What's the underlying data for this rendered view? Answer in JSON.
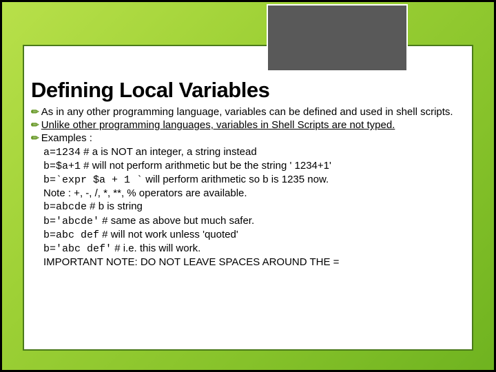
{
  "title": "Defining Local Variables",
  "bullets": {
    "b1": "As in any other programming language, variables can be defined and used in shell scripts.",
    "b2": "Unlike other programming languages, variables in Shell Scripts are not typed.",
    "b3_label": "Examples :",
    "ex1_code": "a=1234",
    "ex1_comment": "  # a is NOT an integer, a string instead",
    "ex2_code": "b=$a+1",
    "ex2_comment": " # will not perform arithmetic but be the string ' 1234+1'",
    "ex3_code": "b=`expr $a + 1 `",
    "ex3_comment": "   will perform arithmetic so b is 1235 now.",
    "ex3_note": "       Note : +, -, /, *, **, % operators are available.",
    "ex4_code": "b=abcde",
    "ex4_comment": "  # b is string",
    "ex5_code": "b='abcde'",
    "ex5_comment": " # same as above but much safer.",
    "ex6_code": "b=abc  def",
    "ex6_comment": " # will not work unless 'quoted'",
    "ex7_code": "b='abc def'",
    "ex7_comment": "  # i.e. this will work.",
    "important": "IMPORTANT NOTE: DO NOT LEAVE SPACES AROUND THE ="
  }
}
